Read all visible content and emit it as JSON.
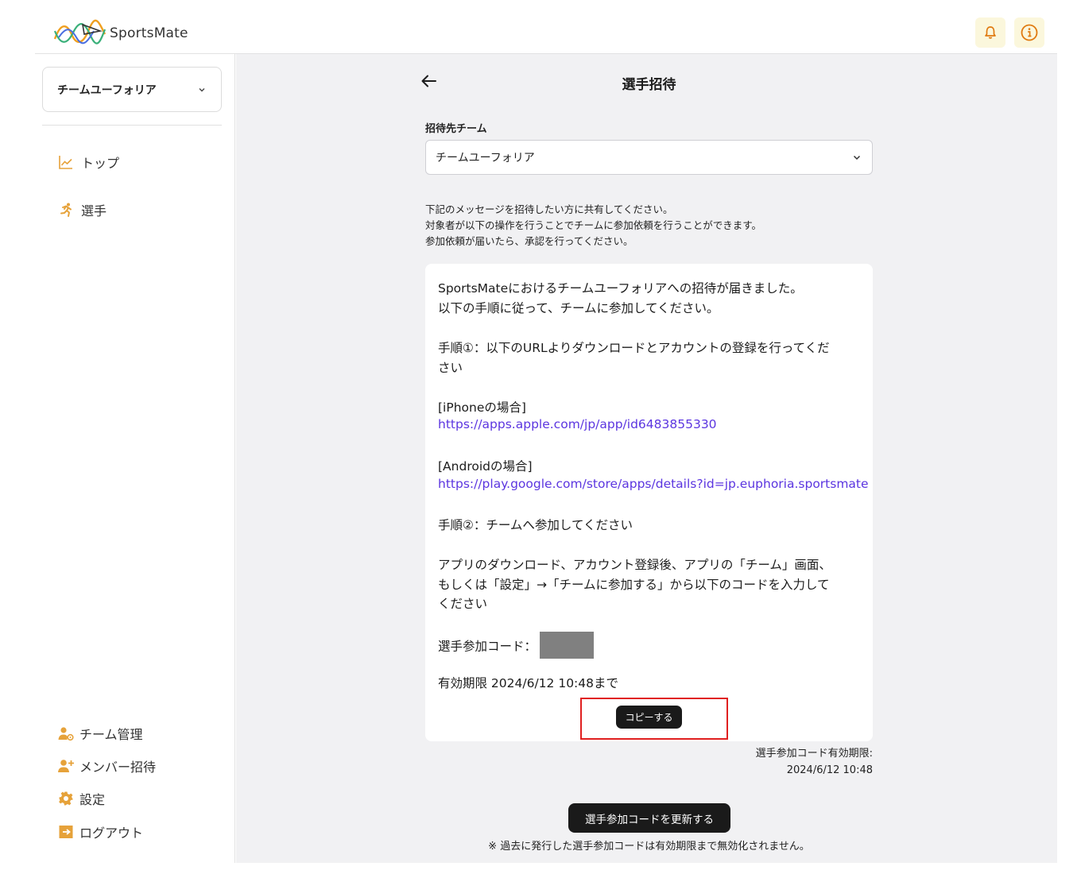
{
  "header": {
    "logo_text": "SportsMate",
    "brand_color": "#f0a020",
    "icons": [
      "bell-icon",
      "info-icon"
    ]
  },
  "sidebar": {
    "team_select_value": "チームユーフォリア",
    "nav_items": [
      {
        "label": "トップ",
        "icon": "chart-icon"
      },
      {
        "label": "選手",
        "icon": "runner-icon"
      }
    ],
    "bottom_items": [
      {
        "label": "チーム管理",
        "icon": "team-manage-icon"
      },
      {
        "label": "メンバー招待",
        "icon": "add-member-icon"
      },
      {
        "label": "設定",
        "icon": "gear-icon"
      },
      {
        "label": "ログアウト",
        "icon": "logout-icon"
      }
    ]
  },
  "main": {
    "title": "選手招待",
    "team_field_label": "招待先チーム",
    "team_field_value": "チームユーフォリア",
    "instructions": [
      "下記のメッセージを招待したい方に共有してください。",
      "対象者が以下の操作を行うことでチームに参加依頼を行うことができます。",
      "参加依頼が届いたら、承認を行ってください。"
    ],
    "message": {
      "line1": "SportsMateにおけるチームユーフォリアへの招待が届きました。",
      "line2": "以下の手順に従って、チームに参加してください。",
      "step1_a": "手順①：以下のURLよりダウンロードとアカウントの登録を行ってくだ",
      "step1_b": "さい",
      "iphone_label": "[iPhoneの場合]",
      "iphone_url": "https://apps.apple.com/jp/app/id6483855330",
      "android_label": "[Androidの場合]",
      "android_url": "https://play.google.com/store/apps/details?id=jp.euphoria.sportsmate",
      "step2": "手順②：チームへ参加してください",
      "desc_a": "アプリのダウンロード、アカウント登録後、アプリの「チーム」画面、",
      "desc_b": "もしくは「設定」→「チームに参加する」から以下のコードを入力して",
      "desc_c": "ください",
      "code_label": "選手参加コード：",
      "expiry": "有効期限 2024/6/12 10:48まで",
      "copy_button": "コピーする"
    },
    "expiry_label_a": "選手参加コード有効期限:",
    "expiry_label_b": "2024/6/12 10:48",
    "refresh_button": "選手参加コードを更新する",
    "note": "※ 過去に発行した選手参加コードは有効期限まで無効化されません。"
  }
}
